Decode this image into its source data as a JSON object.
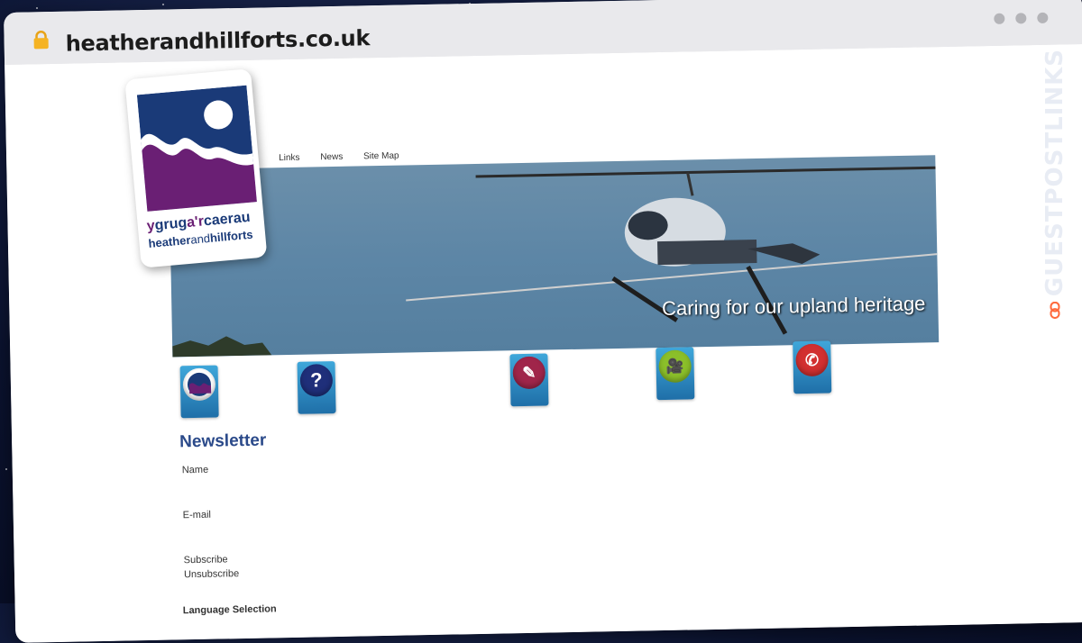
{
  "browser": {
    "url": "heatherandhillforts.co.uk",
    "icons": {
      "lock": "lock-icon",
      "window_dots": "window-control-dots"
    }
  },
  "logo": {
    "line1_prefix": "y",
    "line1_grug": "grug",
    "line1_ar": "a'r",
    "line1_caerau": "caerau",
    "line2_heather": "heather",
    "line2_and": "and",
    "line2_hillforts": "hillforts"
  },
  "nav": {
    "items": [
      "Links",
      "News",
      "Site Map"
    ]
  },
  "banner": {
    "caption": "Caring for our upland heritage"
  },
  "feature_icons": [
    {
      "name": "logo-wave-icon",
      "color": "#6a1f74"
    },
    {
      "name": "question-icon",
      "color": "#1f2f7a"
    },
    {
      "name": "pencil-icon",
      "color": "#a0254a"
    },
    {
      "name": "camera-icon",
      "color": "#8bbf2a"
    },
    {
      "name": "phone-icon",
      "color": "#d23030"
    }
  ],
  "newsletter": {
    "title": "Newsletter",
    "name_label": "Name",
    "email_label": "E-mail",
    "subscribe_label": "Subscribe",
    "unsubscribe_label": "Unsubscribe",
    "language_heading": "Language Selection"
  },
  "side_brand": {
    "text": "GUESTPOSTLINKS",
    "accent": "#ff6a3d"
  }
}
